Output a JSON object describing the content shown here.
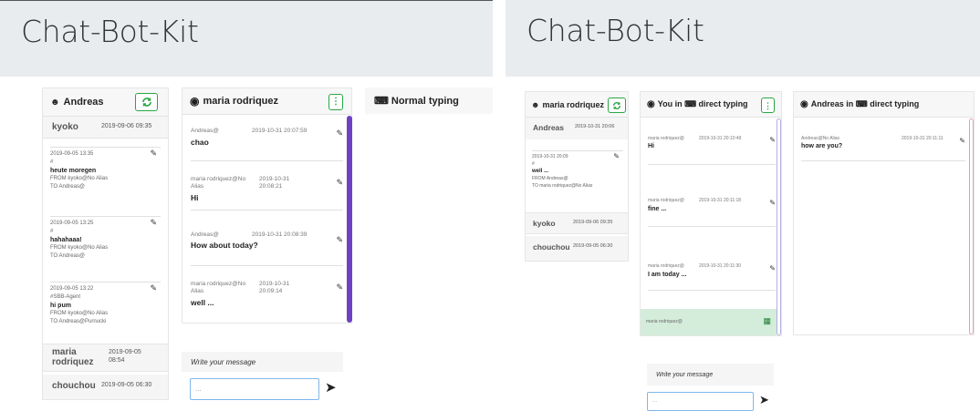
{
  "app_title": "Chat-Bot-Kit",
  "left": {
    "users_panel": {
      "current_user": "Andreas",
      "contacts": [
        {
          "name": "kyoko",
          "date": "2019-09-06 09:35"
        },
        {
          "name": "maria rodriquez",
          "date": "2019-09-05 08:54"
        },
        {
          "name": "chouchou",
          "date": "2019-09-05 06:30"
        }
      ],
      "messages": [
        {
          "date": "2019-09-05 13:35",
          "hash": "#",
          "text": "heute moregen",
          "from": "FROM kyoko@No Alias",
          "to": "TO Andreas@"
        },
        {
          "date": "2019-09-05 13:25",
          "hash": "#",
          "text": "hahahaaa!",
          "from": "FROM kyoko@No Alias",
          "to": "TO Andreas@"
        },
        {
          "date": "2019-09-05 13:22",
          "hash": "#SBB-Agent",
          "text": "hi pum",
          "from": "FROM kyoko@No Alias",
          "to": "TO Andreas@Purnucki"
        }
      ]
    },
    "chat_panel": {
      "title": "maria rodriquez",
      "messages": [
        {
          "meta": "Andreas@",
          "date": "2019-10-31 20:07:59",
          "text": "chao"
        },
        {
          "meta": "maria rodriquez@No Alias",
          "date": "2019-10-31 20:08:21",
          "text": "Hi"
        },
        {
          "meta": "Andreas@",
          "date": "2019-10-31 20:08:39",
          "text": "How about today?"
        },
        {
          "meta": "maria rodriquez@No Alias",
          "date": "2019-10-31 20:09:14",
          "text": "well ..."
        }
      ],
      "write_label": "Write your message",
      "input_value": "..."
    },
    "typing_panel": {
      "title": "Normal typing"
    }
  },
  "right": {
    "users_panel": {
      "current_user": "maria rodriquez",
      "contacts": [
        {
          "name": "Andreas",
          "date": "2019-10-31 20:06"
        },
        {
          "name": "kyoko",
          "date": "2019-09-06 09:35"
        },
        {
          "name": "chouchou",
          "date": "2019-09-05 06:30"
        }
      ],
      "message": {
        "date": "2019-10-31 20:09",
        "hash": "#",
        "text": "well ...",
        "from": "FROM Andreas@",
        "to": "TO maria rodriquez@No Alias"
      }
    },
    "chat_panel": {
      "title": "You in ⌨ direct typing",
      "messages": [
        {
          "meta": "maria rodriquez@",
          "date": "2019-10-31 20:10:49",
          "text": "Hi"
        },
        {
          "meta": "maria rodriquez@",
          "date": "2019-10-31 20:11:18",
          "text": "fine ..."
        },
        {
          "meta": "maria rodriquez@",
          "date": "2019-10-31 20:11:30",
          "text": "I am today ..."
        }
      ],
      "draft_author": "maria rodriquez@",
      "write_label": "Write your message",
      "input_value": "..."
    },
    "andreas_panel": {
      "title": "Andreas in ⌨ direct typing",
      "message": {
        "meta": "Andreas@No Alias",
        "date": "2019-10-31 20:11:11",
        "text": "how are you?"
      }
    }
  },
  "colors": {
    "header_bg": "#e9ecef",
    "accent_green": "#28a745",
    "scroll_purple": "#6f42c1",
    "scroll_lavender": "#b5aee0",
    "scroll_pink": "#e8a0b0",
    "draft_green": "#d4edda"
  }
}
